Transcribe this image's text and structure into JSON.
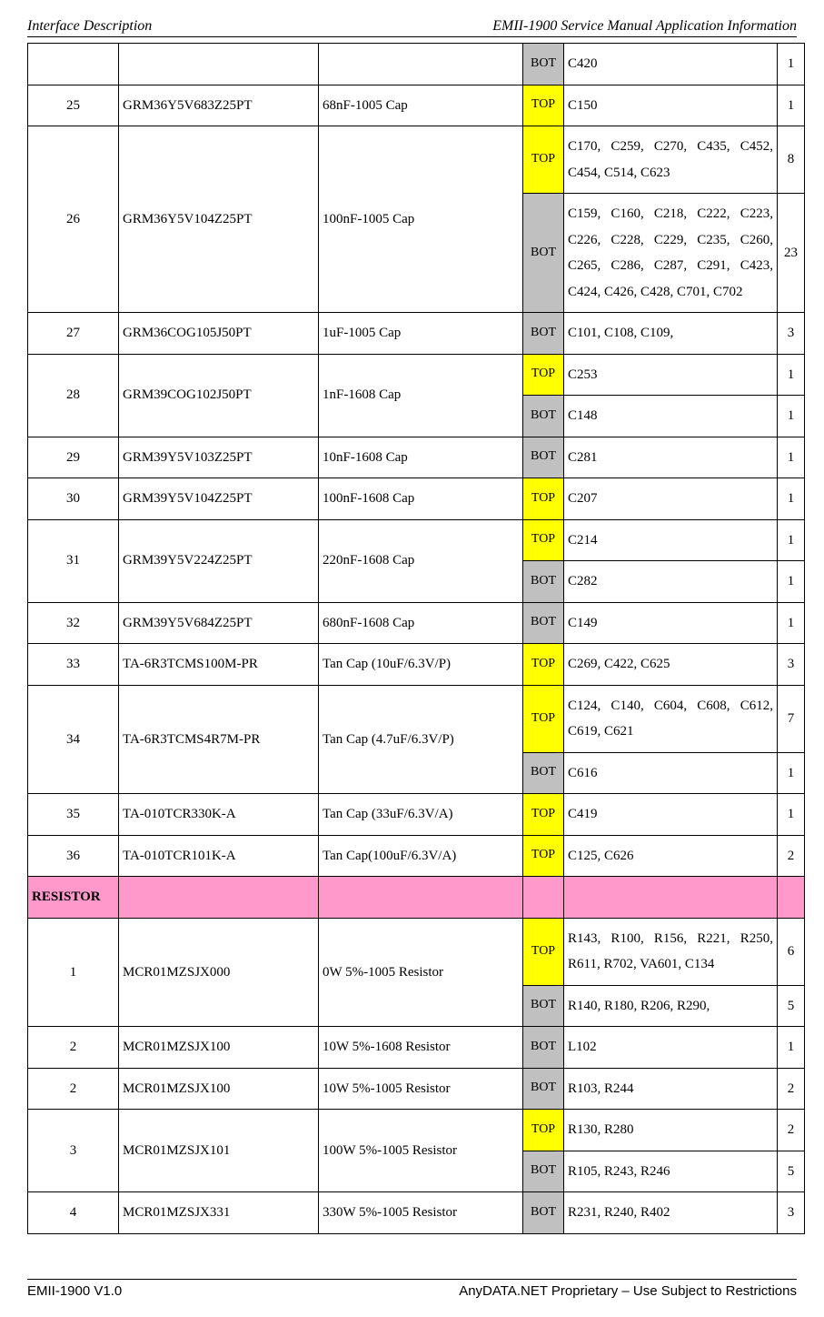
{
  "header": {
    "left": "Interface Description",
    "right": "EMII-1900 Service Manual Application Information"
  },
  "footer": {
    "left": "EMII-1900 V1.0",
    "right": "AnyDATA.NET Proprietary – Use Subject to Restrictions"
  },
  "section_label": "RESISTOR",
  "rows": [
    {
      "idx": "",
      "part": "",
      "desc": "",
      "cells": [
        {
          "layer": "BOT",
          "refs": "C420",
          "qty": "1"
        }
      ]
    },
    {
      "idx": "25",
      "part": "GRM36Y5V683Z25PT",
      "desc": "68nF-1005 Cap",
      "cells": [
        {
          "layer": "TOP",
          "refs": "C150",
          "qty": "1"
        }
      ]
    },
    {
      "idx": "26",
      "part": "GRM36Y5V104Z25PT",
      "desc": "100nF-1005 Cap",
      "cells": [
        {
          "layer": "TOP",
          "refs": "C170, C259, C270, C435, C452, C454, C514, C623",
          "qty": "8"
        },
        {
          "layer": "BOT",
          "refs": "C159, C160, C218, C222, C223, C226, C228, C229, C235, C260, C265, C286, C287, C291, C423, C424, C426, C428, C701, C702",
          "qty": "23"
        }
      ]
    },
    {
      "idx": "27",
      "part": "GRM36COG105J50PT",
      "desc": "1uF-1005 Cap",
      "cells": [
        {
          "layer": "BOT",
          "refs": "C101, C108, C109,",
          "qty": "3"
        }
      ]
    },
    {
      "idx": "28",
      "part": "GRM39COG102J50PT",
      "desc": "1nF-1608 Cap",
      "cells": [
        {
          "layer": "TOP",
          "refs": "C253",
          "qty": "1"
        },
        {
          "layer": "BOT",
          "refs": "C148",
          "qty": "1"
        }
      ]
    },
    {
      "idx": "29",
      "part": "GRM39Y5V103Z25PT",
      "desc": "10nF-1608 Cap",
      "cells": [
        {
          "layer": "BOT",
          "refs": "C281",
          "qty": "1"
        }
      ]
    },
    {
      "idx": "30",
      "part": "GRM39Y5V104Z25PT",
      "desc": "100nF-1608 Cap",
      "cells": [
        {
          "layer": "TOP",
          "refs": "C207",
          "qty": "1"
        }
      ]
    },
    {
      "idx": "31",
      "part": "GRM39Y5V224Z25PT",
      "desc": "220nF-1608 Cap",
      "cells": [
        {
          "layer": "TOP",
          "refs": "C214",
          "qty": "1"
        },
        {
          "layer": "BOT",
          "refs": "C282",
          "qty": "1"
        }
      ]
    },
    {
      "idx": "32",
      "part": "GRM39Y5V684Z25PT",
      "desc": "680nF-1608 Cap",
      "cells": [
        {
          "layer": "BOT",
          "refs": "C149",
          "qty": "1"
        }
      ]
    },
    {
      "idx": "33",
      "part": "TA-6R3TCMS100M-PR",
      "desc": "Tan Cap (10uF/6.3V/P)",
      "cells": [
        {
          "layer": "TOP",
          "refs": "C269, C422, C625",
          "qty": "3"
        }
      ]
    },
    {
      "idx": "34",
      "part": "TA-6R3TCMS4R7M-PR",
      "desc": "Tan Cap (4.7uF/6.3V/P)",
      "cells": [
        {
          "layer": "TOP",
          "refs": "C124, C140, C604, C608, C612, C619, C621",
          "qty": "7"
        },
        {
          "layer": "BOT",
          "refs": "C616",
          "qty": "1"
        }
      ]
    },
    {
      "idx": "35",
      "part": "TA-010TCR330K-A",
      "desc": "Tan Cap (33uF/6.3V/A)",
      "cells": [
        {
          "layer": "TOP",
          "refs": "C419",
          "qty": "1"
        }
      ]
    },
    {
      "idx": "36",
      "part": "TA-010TCR101K-A",
      "desc": "Tan Cap(100uF/6.3V/A)",
      "cells": [
        {
          "layer": "TOP",
          "refs": "C125, C626",
          "qty": "2"
        }
      ]
    },
    {
      "section": true
    },
    {
      "idx": "1",
      "part": "MCR01MZSJX000",
      "desc": "0W 5%-1005 Resistor",
      "cells": [
        {
          "layer": "TOP",
          "refs": "R143, R100,  R156, R221, R250, R611, R702,  VA601, C134",
          "qty": "6"
        },
        {
          "layer": "BOT",
          "refs": "R140, R180, R206, R290,",
          "qty": "5"
        }
      ]
    },
    {
      "idx": "2",
      "part": "MCR01MZSJX100",
      "desc": "10W 5%-1608 Resistor",
      "cells": [
        {
          "layer": "BOT",
          "refs": "L102",
          "qty": "1"
        }
      ]
    },
    {
      "idx": "2",
      "part": "MCR01MZSJX100",
      "desc": "10W 5%-1005 Resistor",
      "cells": [
        {
          "layer": "BOT",
          "refs": "R103, R244",
          "qty": "2"
        }
      ]
    },
    {
      "idx": "3",
      "part": "MCR01MZSJX101",
      "desc": "100W 5%-1005 Resistor",
      "cells": [
        {
          "layer": "TOP",
          "refs": "R130, R280",
          "qty": "2"
        },
        {
          "layer": "BOT",
          "refs": "R105, R243, R246",
          "qty": "5"
        }
      ]
    },
    {
      "idx": "4",
      "part": "MCR01MZSJX331",
      "desc": "330W 5%-1005 Resistor",
      "cells": [
        {
          "layer": "BOT",
          "refs": "R231, R240, R402",
          "qty": "3"
        }
      ]
    }
  ]
}
